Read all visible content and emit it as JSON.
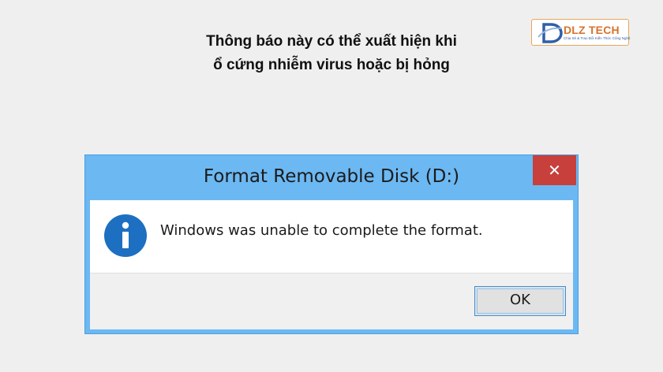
{
  "caption": {
    "line1": "Thông báo này có thể xuất hiện khi",
    "line2": "ổ cứng nhiễm virus hoặc bị hỏng"
  },
  "logo": {
    "brand": "DLZ TECH",
    "tagline": "Chia Sẻ & Trao Đổi Kiến Thức Công Nghệ"
  },
  "dialog": {
    "title": "Format Removable Disk (D:)",
    "close_glyph": "✕",
    "message": "Windows was unable to complete the format.",
    "ok_label": "OK",
    "icon": "info-icon"
  },
  "colors": {
    "titlebar": "#6cb8f2",
    "close_button": "#c7403c",
    "info_icon": "#1d6fc1",
    "logo_text": "#d8722a"
  }
}
